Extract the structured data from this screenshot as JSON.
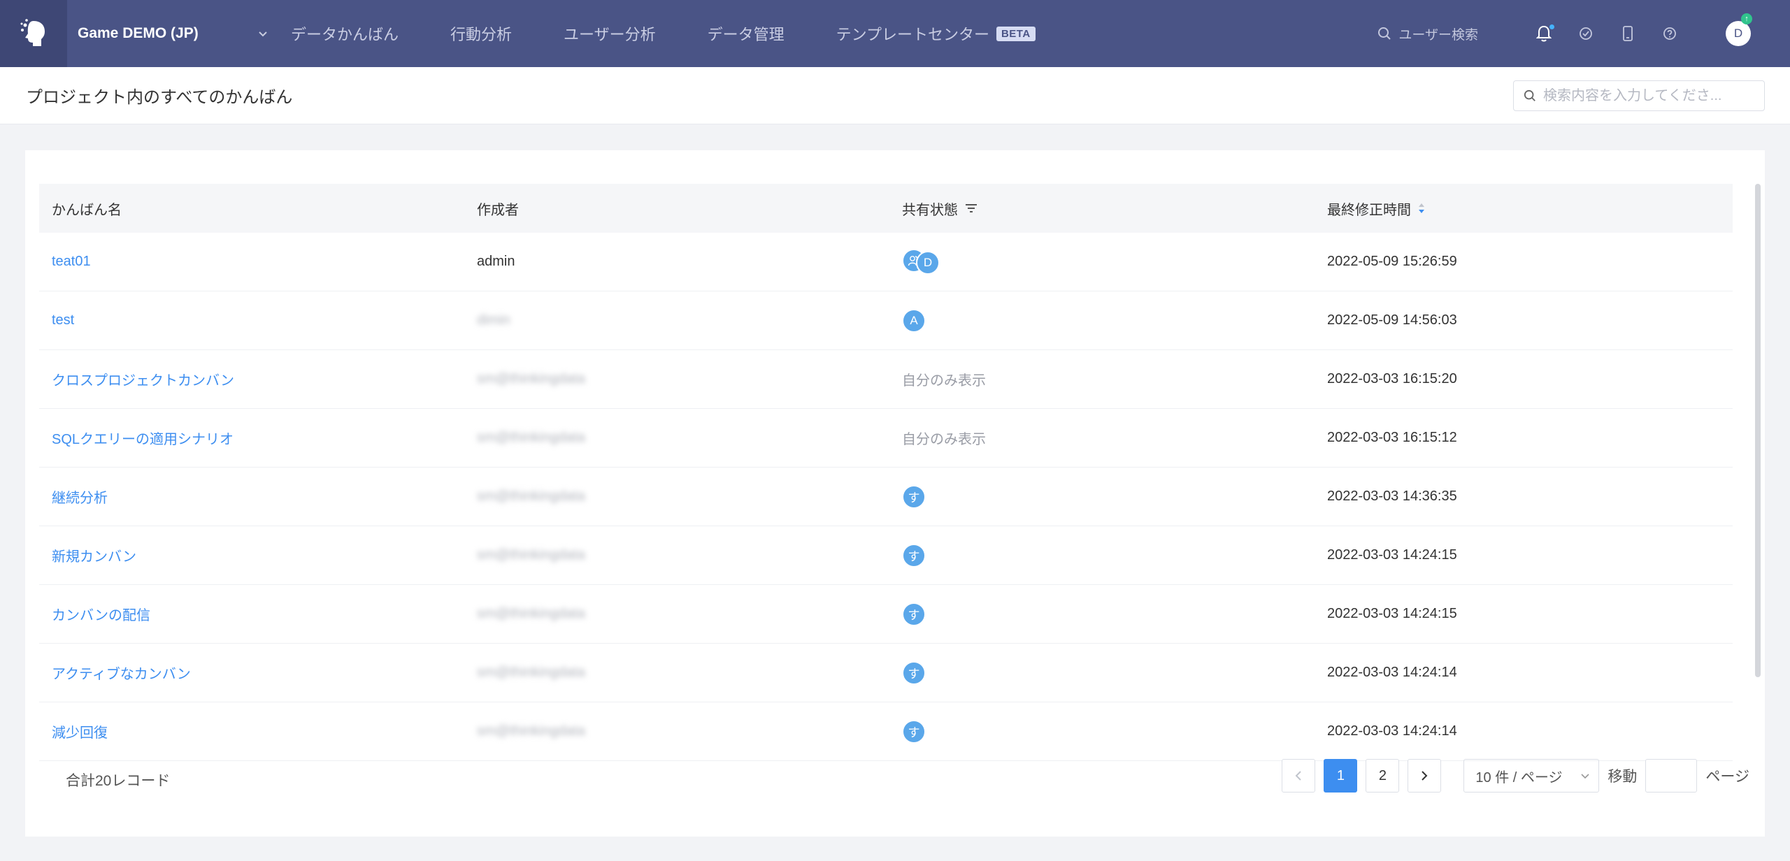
{
  "topbar": {
    "project_name": "Game DEMO (JP)",
    "nav": [
      {
        "label": "データかんばん"
      },
      {
        "label": "行動分析"
      },
      {
        "label": "ユーザー分析"
      },
      {
        "label": "データ管理"
      },
      {
        "label": "テンプレートセンター",
        "badge": "BETA"
      }
    ],
    "user_search_label": "ユーザー検索",
    "avatar_initial": "D",
    "colors": {
      "bar": "#4a5486",
      "accent": "#3d8ef0"
    }
  },
  "subheader": {
    "title": "プロジェクト内のすべてのかんばん",
    "search_placeholder": "検索内容を入力してくださ..."
  },
  "table": {
    "columns": [
      "かんばん名",
      "作成者",
      "共有状態",
      "最終修正時間"
    ],
    "rows": [
      {
        "name": "teat01",
        "creator": "admin",
        "share": {
          "type": "avatars",
          "avatars": [
            "group",
            "D"
          ]
        },
        "modified": "2022-05-09 15:26:59"
      },
      {
        "name": "test",
        "creator": "dimin",
        "share": {
          "type": "avatars",
          "avatars": [
            "A"
          ]
        },
        "modified": "2022-05-09 14:56:03"
      },
      {
        "name": "クロスプロジェクトカンバン",
        "creator": "sm@thinkingdata",
        "share": {
          "type": "text",
          "text": "自分のみ表示"
        },
        "modified": "2022-03-03 16:15:20"
      },
      {
        "name": "SQLクエリーの適用シナリオ",
        "creator": "sm@thinkingdata",
        "share": {
          "type": "text",
          "text": "自分のみ表示"
        },
        "modified": "2022-03-03 16:15:12"
      },
      {
        "name": "継続分析",
        "creator": "sm@thinkingdata",
        "share": {
          "type": "avatars",
          "avatars": [
            "す"
          ]
        },
        "modified": "2022-03-03 14:36:35"
      },
      {
        "name": "新規カンバン",
        "creator": "sm@thinkingdata",
        "share": {
          "type": "avatars",
          "avatars": [
            "す"
          ]
        },
        "modified": "2022-03-03 14:24:15"
      },
      {
        "name": "カンバンの配信",
        "creator": "sm@thinkingdata",
        "share": {
          "type": "avatars",
          "avatars": [
            "す"
          ]
        },
        "modified": "2022-03-03 14:24:15"
      },
      {
        "name": "アクティブなカンバン",
        "creator": "sm@thinkingdata",
        "share": {
          "type": "avatars",
          "avatars": [
            "す"
          ]
        },
        "modified": "2022-03-03 14:24:14"
      },
      {
        "name": "減少回復",
        "creator": "sm@thinkingdata",
        "share": {
          "type": "avatars",
          "avatars": [
            "す"
          ]
        },
        "modified": "2022-03-03 14:24:14"
      }
    ]
  },
  "pagination": {
    "total_label": "合計20レコード",
    "pages": [
      "1",
      "2"
    ],
    "current_page": "1",
    "page_size_label": "10 件 / ページ",
    "jump_label": "移動",
    "page_suffix": "ページ"
  }
}
